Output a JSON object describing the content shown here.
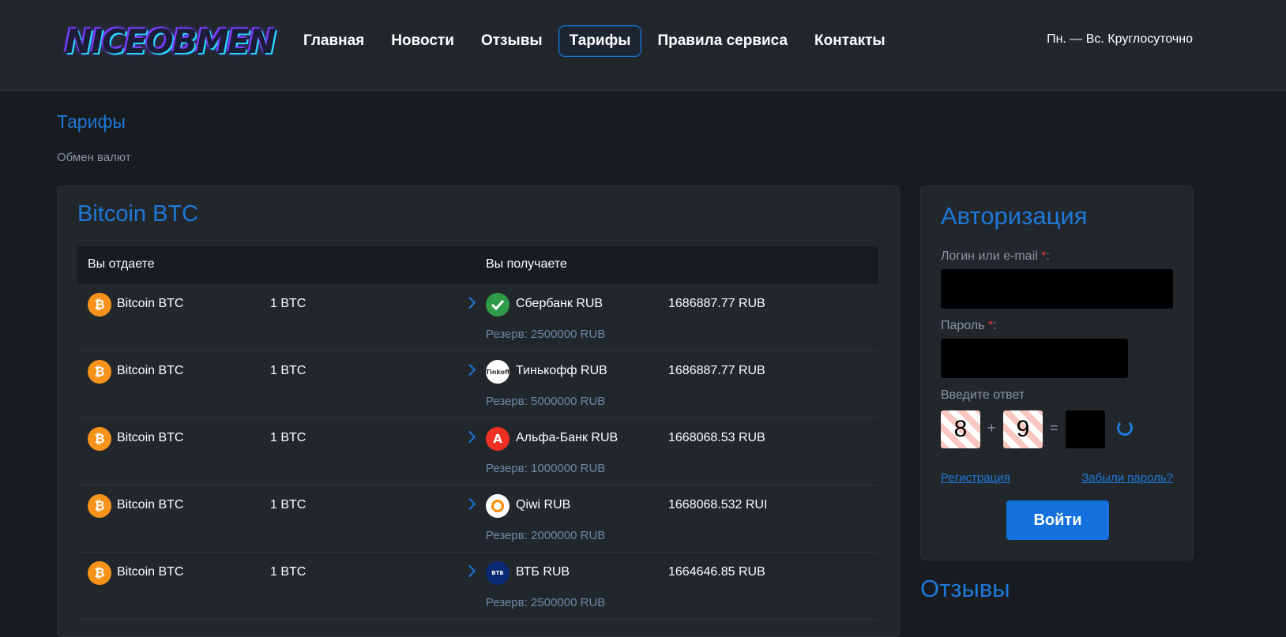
{
  "header": {
    "logo_text": "NICEOBMEN",
    "nav": [
      "Главная",
      "Новости",
      "Отзывы",
      "Тарифы",
      "Правила сервиса",
      "Контакты"
    ],
    "active_index": 3,
    "hours": "Пн. — Вс. Круглосуточно"
  },
  "page": {
    "title": "Тарифы",
    "breadcrumb": "Обмен валют"
  },
  "rates": {
    "title": "Bitcoin BTC",
    "col_give": "Вы отдаете",
    "col_get": "Вы получаете",
    "rows": [
      {
        "give_name": "Bitcoin BTC",
        "give_amount": "1 BTC",
        "get_name": "Сбербанк RUB",
        "get_amount": "1686887.77 RUB",
        "reserve": "Резерв: 2500000 RUB"
      },
      {
        "give_name": "Bitcoin BTC",
        "give_amount": "1 BTC",
        "get_name": "Тинькофф RUB",
        "get_amount": "1686887.77 RUB",
        "reserve": "Резерв: 5000000 RUB"
      },
      {
        "give_name": "Bitcoin BTC",
        "give_amount": "1 BTC",
        "get_name": "Альфа-Банк RUB",
        "get_amount": "1668068.53 RUB",
        "reserve": "Резерв: 1000000 RUB"
      },
      {
        "give_name": "Bitcoin BTC",
        "give_amount": "1 BTC",
        "get_name": "Qiwi RUB",
        "get_amount": "1668068.532 RUI",
        "reserve": "Резерв: 2000000 RUB"
      },
      {
        "give_name": "Bitcoin BTC",
        "give_amount": "1 BTC",
        "get_name": "ВТБ RUB",
        "get_amount": "1664646.85 RUB",
        "reserve": "Резерв: 2500000 RUB"
      }
    ]
  },
  "auth": {
    "title": "Авторизация",
    "login_label": "Логин или e-mail",
    "password_label": "Пароль",
    "required_mark": "*",
    "colon": ":",
    "captcha_label": "Введите ответ",
    "captcha_a": "8",
    "captcha_op": "+",
    "captcha_b": "9",
    "captcha_eq": "=",
    "register_link": "Регистрация",
    "forgot_link": "Забыли пароль?",
    "login_button": "Войти"
  },
  "reviews": {
    "title": "Отзывы"
  },
  "icons": {
    "btc_glyph": "₿",
    "alfa_glyph": "А",
    "tinkoff_glyph": "Tinkoff",
    "vtb_glyph": "ВТБ"
  },
  "colors": {
    "accent": "#1e78d8",
    "background": "#181c20",
    "panel": "#22272c",
    "btc": "#f7931a"
  }
}
